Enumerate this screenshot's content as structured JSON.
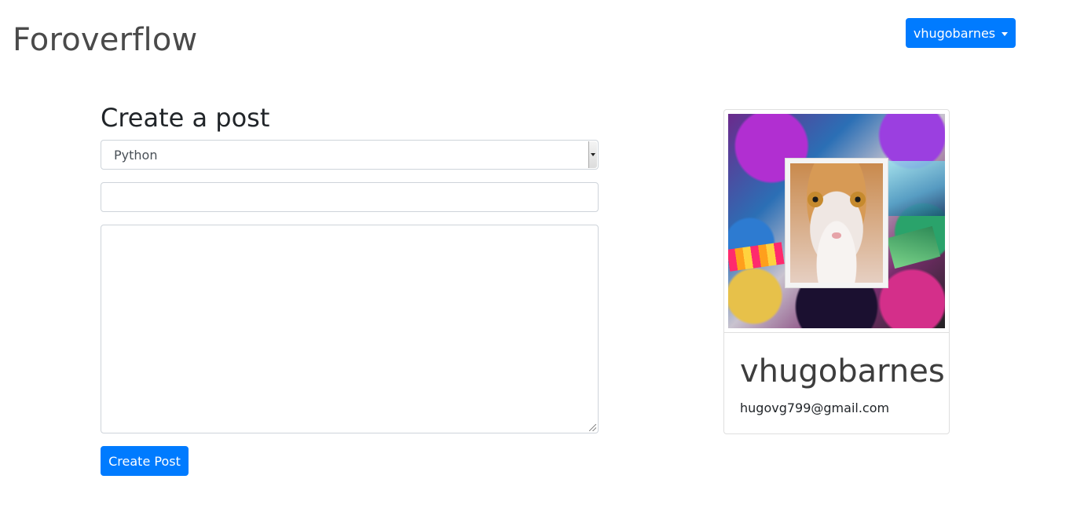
{
  "header": {
    "brand": "Foroverflow",
    "user_menu_label": "vhugobarnes"
  },
  "form": {
    "title": "Create a post",
    "category_selected": "Python",
    "title_input_value": "",
    "body_value": "",
    "submit_label": "Create Post"
  },
  "profile_card": {
    "username": "vhugobarnes",
    "email": "hugovg799@gmail.com",
    "avatar_description": "cat-collage-avatar"
  },
  "colors": {
    "primary": "#007bff",
    "brand_text": "#4a4a4a"
  }
}
